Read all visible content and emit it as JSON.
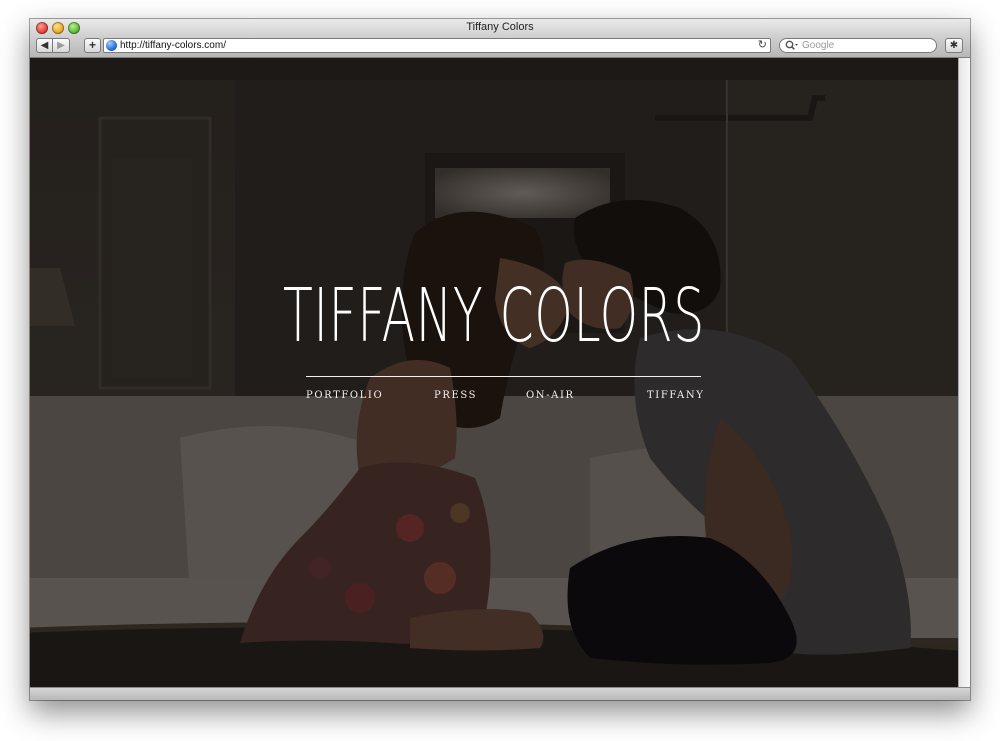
{
  "window": {
    "title": "Tiffany Colors"
  },
  "toolbar": {
    "back_label": "◀",
    "forward_label": "▶",
    "add_label": "+",
    "url": "http://tiffany-colors.com/",
    "reload_glyph": "↻",
    "search_placeholder": "Google",
    "search_glyph": "🔍︎",
    "bug_glyph": "✱"
  },
  "site": {
    "title": "TIFFANY COLORS",
    "nav": [
      {
        "label": "PORTFOLIO"
      },
      {
        "label": "PRESS"
      },
      {
        "label": "ON-AIR"
      },
      {
        "label": "TIFFANY"
      }
    ]
  },
  "icons": {
    "close": "close-icon",
    "minimize": "minimize-icon",
    "maximize": "maximize-icon",
    "globe": "globe-icon",
    "search": "search-icon",
    "reload": "reload-icon",
    "bug": "bug-icon"
  },
  "colors": {
    "title_text": "#ffffff",
    "nav_text": "#f2f2f2"
  }
}
